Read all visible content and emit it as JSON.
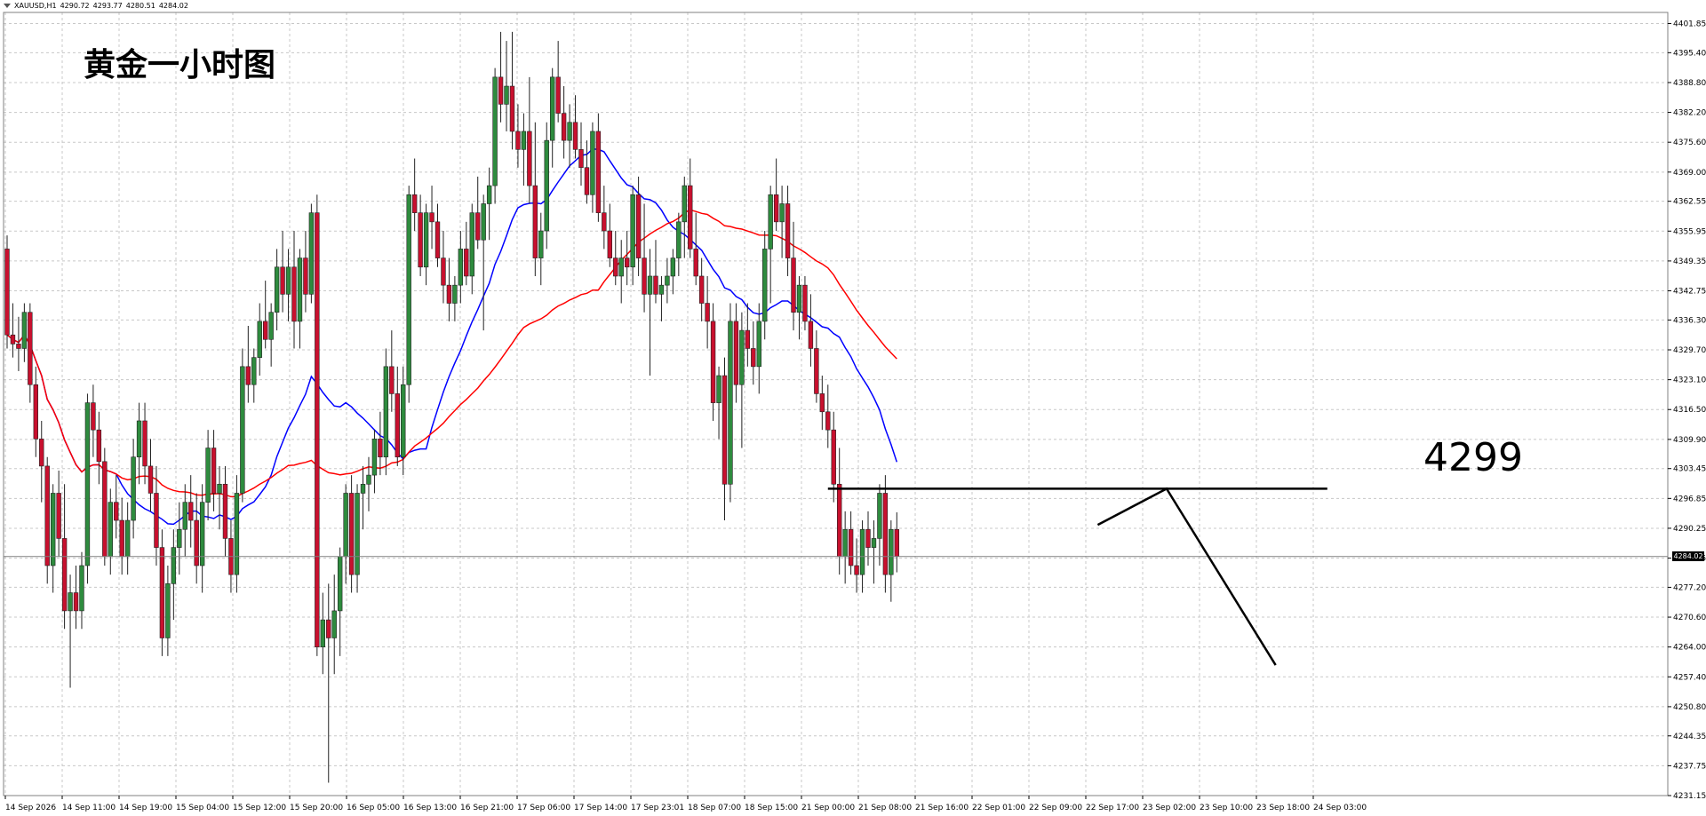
{
  "header": {
    "symbol": "XAUUSD,H1",
    "open": "4290.72",
    "high": "4293.77",
    "low": "4280.51",
    "close": "4284.02"
  },
  "annotations": {
    "title": "黄金一小时图",
    "level_label": "4299"
  },
  "current_price_label": "4284.02",
  "colors": {
    "up_candle": "#2e8b3e",
    "down_candle": "#c8102e",
    "ma_fast": "#0000ff",
    "ma_slow": "#ff0000",
    "grid": "#c8c8c8",
    "annotation": "#000000"
  },
  "chart_data": {
    "type": "candlestick",
    "title": "",
    "xlabel": "",
    "ylabel": "",
    "ylim": [
      4231.15,
      4404.3
    ],
    "grid": true,
    "y_ticks": [
      "4401.85",
      "4395.40",
      "4388.80",
      "4382.20",
      "4375.60",
      "4369.00",
      "4362.55",
      "4355.95",
      "4349.35",
      "4342.75",
      "4336.30",
      "4329.70",
      "4323.10",
      "4316.50",
      "4309.90",
      "4303.45",
      "4296.85",
      "4290.25",
      "4283.65",
      "4277.20",
      "4270.60",
      "4264.00",
      "4257.40",
      "4250.80",
      "4244.35",
      "4237.75",
      "4231.15"
    ],
    "x_ticks": [
      "14 Sep 2026",
      "14 Sep 11:00",
      "14 Sep 19:00",
      "15 Sep 04:00",
      "15 Sep 12:00",
      "15 Sep 20:00",
      "16 Sep 05:00",
      "16 Sep 13:00",
      "16 Sep 21:00",
      "17 Sep 06:00",
      "17 Sep 14:00",
      "17 Sep 23:01",
      "18 Sep 07:00",
      "18 Sep 15:00",
      "21 Sep 00:00",
      "21 Sep 08:00",
      "21 Sep 16:00",
      "22 Sep 01:00",
      "22 Sep 09:00",
      "22 Sep 17:00",
      "23 Sep 02:00",
      "23 Sep 10:00",
      "23 Sep 18:00",
      "24 Sep 03:00"
    ],
    "candles_ohlc": [
      [
        4352,
        4355,
        4330,
        4333
      ],
      [
        4333,
        4340,
        4328,
        4331
      ],
      [
        4331,
        4337,
        4325,
        4330
      ],
      [
        4330,
        4340,
        4327,
        4338
      ],
      [
        4338,
        4340,
        4318,
        4322
      ],
      [
        4322,
        4326,
        4306,
        4310
      ],
      [
        4310,
        4314,
        4296,
        4304
      ],
      [
        4304,
        4306,
        4278,
        4282
      ],
      [
        4282,
        4300,
        4276,
        4298
      ],
      [
        4298,
        4303,
        4284,
        4288
      ],
      [
        4288,
        4300,
        4268,
        4272
      ],
      [
        4272,
        4280,
        4255,
        4276
      ],
      [
        4276,
        4282,
        4268,
        4272
      ],
      [
        4272,
        4285,
        4268,
        4282
      ],
      [
        4282,
        4320,
        4278,
        4318
      ],
      [
        4318,
        4322,
        4306,
        4312
      ],
      [
        4312,
        4316,
        4300,
        4305
      ],
      [
        4305,
        4308,
        4282,
        4284
      ],
      [
        4284,
        4299,
        4280,
        4296
      ],
      [
        4296,
        4302,
        4288,
        4292
      ],
      [
        4292,
        4297,
        4280,
        4284
      ],
      [
        4284,
        4296,
        4280,
        4292
      ],
      [
        4292,
        4310,
        4288,
        4306
      ],
      [
        4306,
        4318,
        4300,
        4314
      ],
      [
        4314,
        4318,
        4300,
        4304
      ],
      [
        4304,
        4310,
        4294,
        4298
      ],
      [
        4298,
        4304,
        4282,
        4286
      ],
      [
        4286,
        4290,
        4262,
        4266
      ],
      [
        4266,
        4282,
        4262,
        4278
      ],
      [
        4278,
        4290,
        4270,
        4286
      ],
      [
        4286,
        4296,
        4280,
        4290
      ],
      [
        4290,
        4300,
        4284,
        4296
      ],
      [
        4296,
        4302,
        4286,
        4292
      ],
      [
        4292,
        4298,
        4278,
        4282
      ],
      [
        4282,
        4300,
        4276,
        4296
      ],
      [
        4296,
        4312,
        4292,
        4308
      ],
      [
        4308,
        4312,
        4294,
        4298
      ],
      [
        4298,
        4304,
        4290,
        4300
      ],
      [
        4300,
        4304,
        4284,
        4288
      ],
      [
        4288,
        4292,
        4276,
        4280
      ],
      [
        4280,
        4302,
        4276,
        4298
      ],
      [
        4298,
        4330,
        4296,
        4326
      ],
      [
        4326,
        4335,
        4318,
        4322
      ],
      [
        4322,
        4330,
        4318,
        4328
      ],
      [
        4328,
        4340,
        4324,
        4336
      ],
      [
        4336,
        4345,
        4330,
        4332
      ],
      [
        4332,
        4340,
        4326,
        4338
      ],
      [
        4338,
        4352,
        4334,
        4348
      ],
      [
        4348,
        4356,
        4338,
        4342
      ],
      [
        4342,
        4352,
        4336,
        4348
      ],
      [
        4348,
        4356,
        4330,
        4336
      ],
      [
        4336,
        4352,
        4330,
        4350
      ],
      [
        4350,
        4356,
        4338,
        4342
      ],
      [
        4342,
        4362,
        4340,
        4360
      ],
      [
        4360,
        4364,
        4262,
        4264
      ],
      [
        4264,
        4276,
        4258,
        4270
      ],
      [
        4270,
        4278,
        4234,
        4266
      ],
      [
        4266,
        4280,
        4258,
        4272
      ],
      [
        4272,
        4286,
        4262,
        4284
      ],
      [
        4284,
        4300,
        4278,
        4298
      ],
      [
        4298,
        4302,
        4276,
        4280
      ],
      [
        4280,
        4300,
        4276,
        4298
      ],
      [
        4298,
        4304,
        4290,
        4300
      ],
      [
        4300,
        4306,
        4294,
        4302
      ],
      [
        4302,
        4312,
        4298,
        4310
      ],
      [
        4310,
        4316,
        4302,
        4306
      ],
      [
        4306,
        4330,
        4302,
        4326
      ],
      [
        4326,
        4334,
        4316,
        4320
      ],
      [
        4320,
        4326,
        4304,
        4306
      ],
      [
        4306,
        4326,
        4302,
        4322
      ],
      [
        4322,
        4366,
        4318,
        4364
      ],
      [
        4364,
        4372,
        4356,
        4360
      ],
      [
        4360,
        4364,
        4346,
        4348
      ],
      [
        4348,
        4362,
        4344,
        4360
      ],
      [
        4360,
        4366,
        4352,
        4358
      ],
      [
        4358,
        4362,
        4348,
        4350
      ],
      [
        4350,
        4356,
        4340,
        4344
      ],
      [
        4344,
        4350,
        4336,
        4340
      ],
      [
        4340,
        4346,
        4336,
        4344
      ],
      [
        4344,
        4356,
        4340,
        4352
      ],
      [
        4352,
        4358,
        4344,
        4346
      ],
      [
        4346,
        4362,
        4342,
        4360
      ],
      [
        4360,
        4368,
        4352,
        4354
      ],
      [
        4354,
        4364,
        4334,
        4362
      ],
      [
        4362,
        4370,
        4354,
        4366
      ],
      [
        4366,
        4392,
        4362,
        4390
      ],
      [
        4390,
        4400,
        4380,
        4384
      ],
      [
        4384,
        4398,
        4378,
        4388
      ],
      [
        4388,
        4400,
        4374,
        4378
      ],
      [
        4378,
        4384,
        4370,
        4374
      ],
      [
        4374,
        4382,
        4366,
        4378
      ],
      [
        4378,
        4390,
        4362,
        4366
      ],
      [
        4366,
        4380,
        4346,
        4350
      ],
      [
        4350,
        4360,
        4344,
        4356
      ],
      [
        4356,
        4380,
        4352,
        4376
      ],
      [
        4376,
        4392,
        4370,
        4390
      ],
      [
        4390,
        4398,
        4380,
        4382
      ],
      [
        4382,
        4388,
        4372,
        4376
      ],
      [
        4376,
        4384,
        4370,
        4380
      ],
      [
        4380,
        4386,
        4372,
        4374
      ],
      [
        4374,
        4380,
        4366,
        4370
      ],
      [
        4370,
        4376,
        4362,
        4364
      ],
      [
        4364,
        4380,
        4360,
        4378
      ],
      [
        4378,
        4382,
        4358,
        4360
      ],
      [
        4360,
        4366,
        4352,
        4356
      ],
      [
        4356,
        4362,
        4348,
        4350
      ],
      [
        4350,
        4356,
        4344,
        4346
      ],
      [
        4346,
        4354,
        4340,
        4350
      ],
      [
        4350,
        4356,
        4344,
        4348
      ],
      [
        4348,
        4366,
        4344,
        4364
      ],
      [
        4364,
        4368,
        4346,
        4350
      ],
      [
        4350,
        4362,
        4338,
        4342
      ],
      [
        4342,
        4352,
        4324,
        4346
      ],
      [
        4346,
        4354,
        4340,
        4342
      ],
      [
        4342,
        4346,
        4336,
        4344
      ],
      [
        4344,
        4350,
        4340,
        4346
      ],
      [
        4346,
        4352,
        4342,
        4350
      ],
      [
        4350,
        4360,
        4346,
        4358
      ],
      [
        4358,
        4368,
        4350,
        4366
      ],
      [
        4366,
        4372,
        4350,
        4352
      ],
      [
        4352,
        4360,
        4344,
        4346
      ],
      [
        4346,
        4350,
        4336,
        4340
      ],
      [
        4340,
        4346,
        4330,
        4336
      ],
      [
        4336,
        4340,
        4314,
        4318
      ],
      [
        4318,
        4326,
        4310,
        4324
      ],
      [
        4324,
        4328,
        4292,
        4300
      ],
      [
        4300,
        4340,
        4296,
        4336
      ],
      [
        4336,
        4340,
        4318,
        4322
      ],
      [
        4322,
        4338,
        4308,
        4334
      ],
      [
        4334,
        4340,
        4326,
        4330
      ],
      [
        4330,
        4336,
        4322,
        4326
      ],
      [
        4326,
        4340,
        4320,
        4336
      ],
      [
        4336,
        4356,
        4332,
        4352
      ],
      [
        4352,
        4366,
        4340,
        4364
      ],
      [
        4364,
        4372,
        4356,
        4358
      ],
      [
        4358,
        4366,
        4350,
        4362
      ],
      [
        4362,
        4366,
        4346,
        4350
      ],
      [
        4350,
        4358,
        4334,
        4338
      ],
      [
        4338,
        4346,
        4332,
        4344
      ],
      [
        4344,
        4346,
        4334,
        4336
      ],
      [
        4336,
        4342,
        4326,
        4330
      ],
      [
        4330,
        4334,
        4318,
        4320
      ],
      [
        4320,
        4324,
        4312,
        4316
      ],
      [
        4316,
        4322,
        4308,
        4312
      ],
      [
        4312,
        4316,
        4296,
        4300
      ],
      [
        4300,
        4308,
        4280,
        4284
      ],
      [
        4284,
        4294,
        4278,
        4290
      ],
      [
        4290,
        4294,
        4280,
        4282
      ],
      [
        4282,
        4288,
        4276,
        4280
      ],
      [
        4280,
        4292,
        4276,
        4290
      ],
      [
        4290,
        4294,
        4282,
        4286
      ],
      [
        4286,
        4292,
        4278,
        4288
      ],
      [
        4288,
        4300,
        4282,
        4298
      ],
      [
        4298,
        4302,
        4276,
        4280
      ],
      [
        4280,
        4292,
        4274,
        4290
      ],
      [
        4290,
        4293.77,
        4280.51,
        4284.02
      ]
    ],
    "overlays": [
      {
        "type": "horizontal_line",
        "price": 4299
      },
      {
        "type": "projection_path",
        "shape": "small rise to 4299 then sharp decline"
      }
    ]
  }
}
